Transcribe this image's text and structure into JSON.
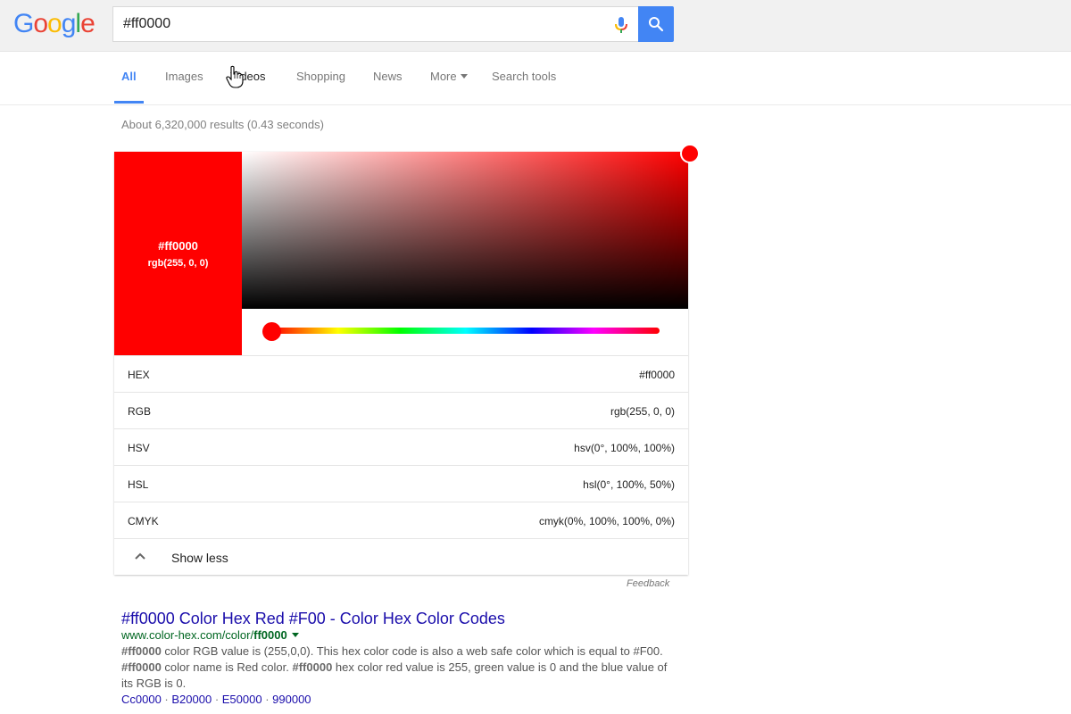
{
  "header": {
    "logo": {
      "letters": [
        "G",
        "o",
        "o",
        "g",
        "l",
        "e"
      ]
    },
    "search": {
      "value": "#ff0000",
      "placeholder": ""
    },
    "icons": {
      "mic": "microphone-icon",
      "search": "magnifier-icon"
    }
  },
  "tabs": [
    {
      "label": "All",
      "active": true
    },
    {
      "label": "Images",
      "active": false
    },
    {
      "label": "Videos",
      "active": false
    },
    {
      "label": "Shopping",
      "active": false
    },
    {
      "label": "News",
      "active": false
    },
    {
      "label": "More",
      "active": false
    },
    {
      "label": "Search tools",
      "active": false
    }
  ],
  "result_stats": "About 6,320,000 results (0.43 seconds)",
  "color_picker": {
    "selected_color": "#ff0000",
    "swatch_hex": "#ff0000",
    "swatch_rgb": "rgb(255, 0, 0)",
    "hue_degrees": 0,
    "saturation_percent": 100,
    "value_percent": 100,
    "rows": [
      {
        "label": "HEX",
        "value": "#ff0000"
      },
      {
        "label": "RGB",
        "value": "rgb(255, 0, 0)"
      },
      {
        "label": "HSV",
        "value": "hsv(0°, 100%, 100%)"
      },
      {
        "label": "HSL",
        "value": "hsl(0°, 100%, 50%)"
      },
      {
        "label": "CMYK",
        "value": "cmyk(0%, 100%, 100%, 0%)"
      }
    ],
    "show_less_label": "Show less",
    "feedback_label": "Feedback"
  },
  "results": [
    {
      "title": "#ff0000 Color Hex Red #F00 - Color Hex Color Codes",
      "url_prefix": "www.color-hex.com/color/",
      "url_bold": "ff0000",
      "snippet": [
        {
          "text": "#ff0000",
          "bold": true
        },
        {
          "text": " color RGB value is (255,0,0). This hex color code is also a web safe color which is equal to #F00. ",
          "bold": false
        },
        {
          "text": "#ff0000",
          "bold": true
        },
        {
          "text": " color name is Red color. ",
          "bold": false
        },
        {
          "text": "#ff0000",
          "bold": true
        },
        {
          "text": " hex color red value is 255, green value is 0 and the blue value of its RGB is 0.",
          "bold": false
        }
      ],
      "sitelinks": [
        "Cc0000",
        "B20000",
        "E50000",
        "990000"
      ],
      "sitelink_separator": " · "
    }
  ]
}
